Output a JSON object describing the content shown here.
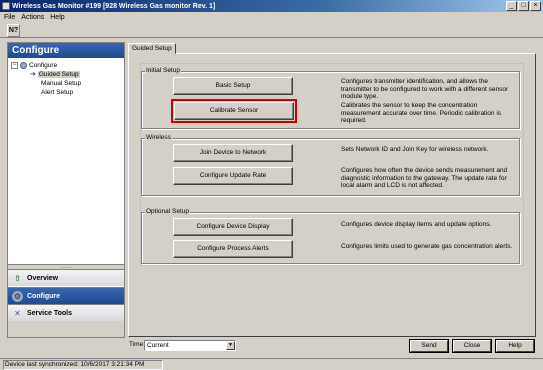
{
  "window": {
    "title": "Wireless Gas Monitor #199 [928 Wireless Gas monitor Rev. 1]",
    "minimize": "_",
    "maximize": "□",
    "close": "×"
  },
  "menu": [
    "File",
    "Actions",
    "Help"
  ],
  "toolbar": {
    "help_icon_text": "N?"
  },
  "left": {
    "header": "Configure",
    "tree": {
      "root": "Configure",
      "expander": "−",
      "children": [
        "Guided Setup",
        "Manual Setup",
        "Alert Setup"
      ]
    },
    "splitter": "........",
    "nav": [
      "Overview",
      "Configure",
      "Service Tools"
    ]
  },
  "tab": "Guided Setup",
  "groups": {
    "initial": {
      "title": "Initial Setup",
      "items": [
        {
          "button": "Basic Setup",
          "desc": "Configures transmitter identification, and allows the transmitter to be configured to work with a different sensor module type."
        },
        {
          "button": "Calibrate Sensor",
          "desc": "Calibrates the sensor to keep the concentration measurement accurate over time. Periodic calibration is required."
        }
      ]
    },
    "wireless": {
      "title": "Wireless",
      "items": [
        {
          "button": "Join Device to Network",
          "desc": "Sets Network ID and Join Key for wireless network."
        },
        {
          "button": "Configure Update Rate",
          "desc": "Configures how often the device sends measurement and diagnostic information to the gateway. The update rate for local alarm and LCD is not affected."
        }
      ]
    },
    "optional": {
      "title": "Optional Setup",
      "items": [
        {
          "button": "Configure Device Display",
          "desc": "Configures device display items and update options."
        },
        {
          "button": "Configure Process Alerts",
          "desc": "Configures limits used to generate gas concentration alerts."
        }
      ]
    }
  },
  "bottom": {
    "time_label": "Time:",
    "time_value": "Current",
    "send": "Send",
    "close": "Close",
    "help": "Help"
  },
  "status": "Device last synchronized: 10/6/2017 3:21:34 PM"
}
